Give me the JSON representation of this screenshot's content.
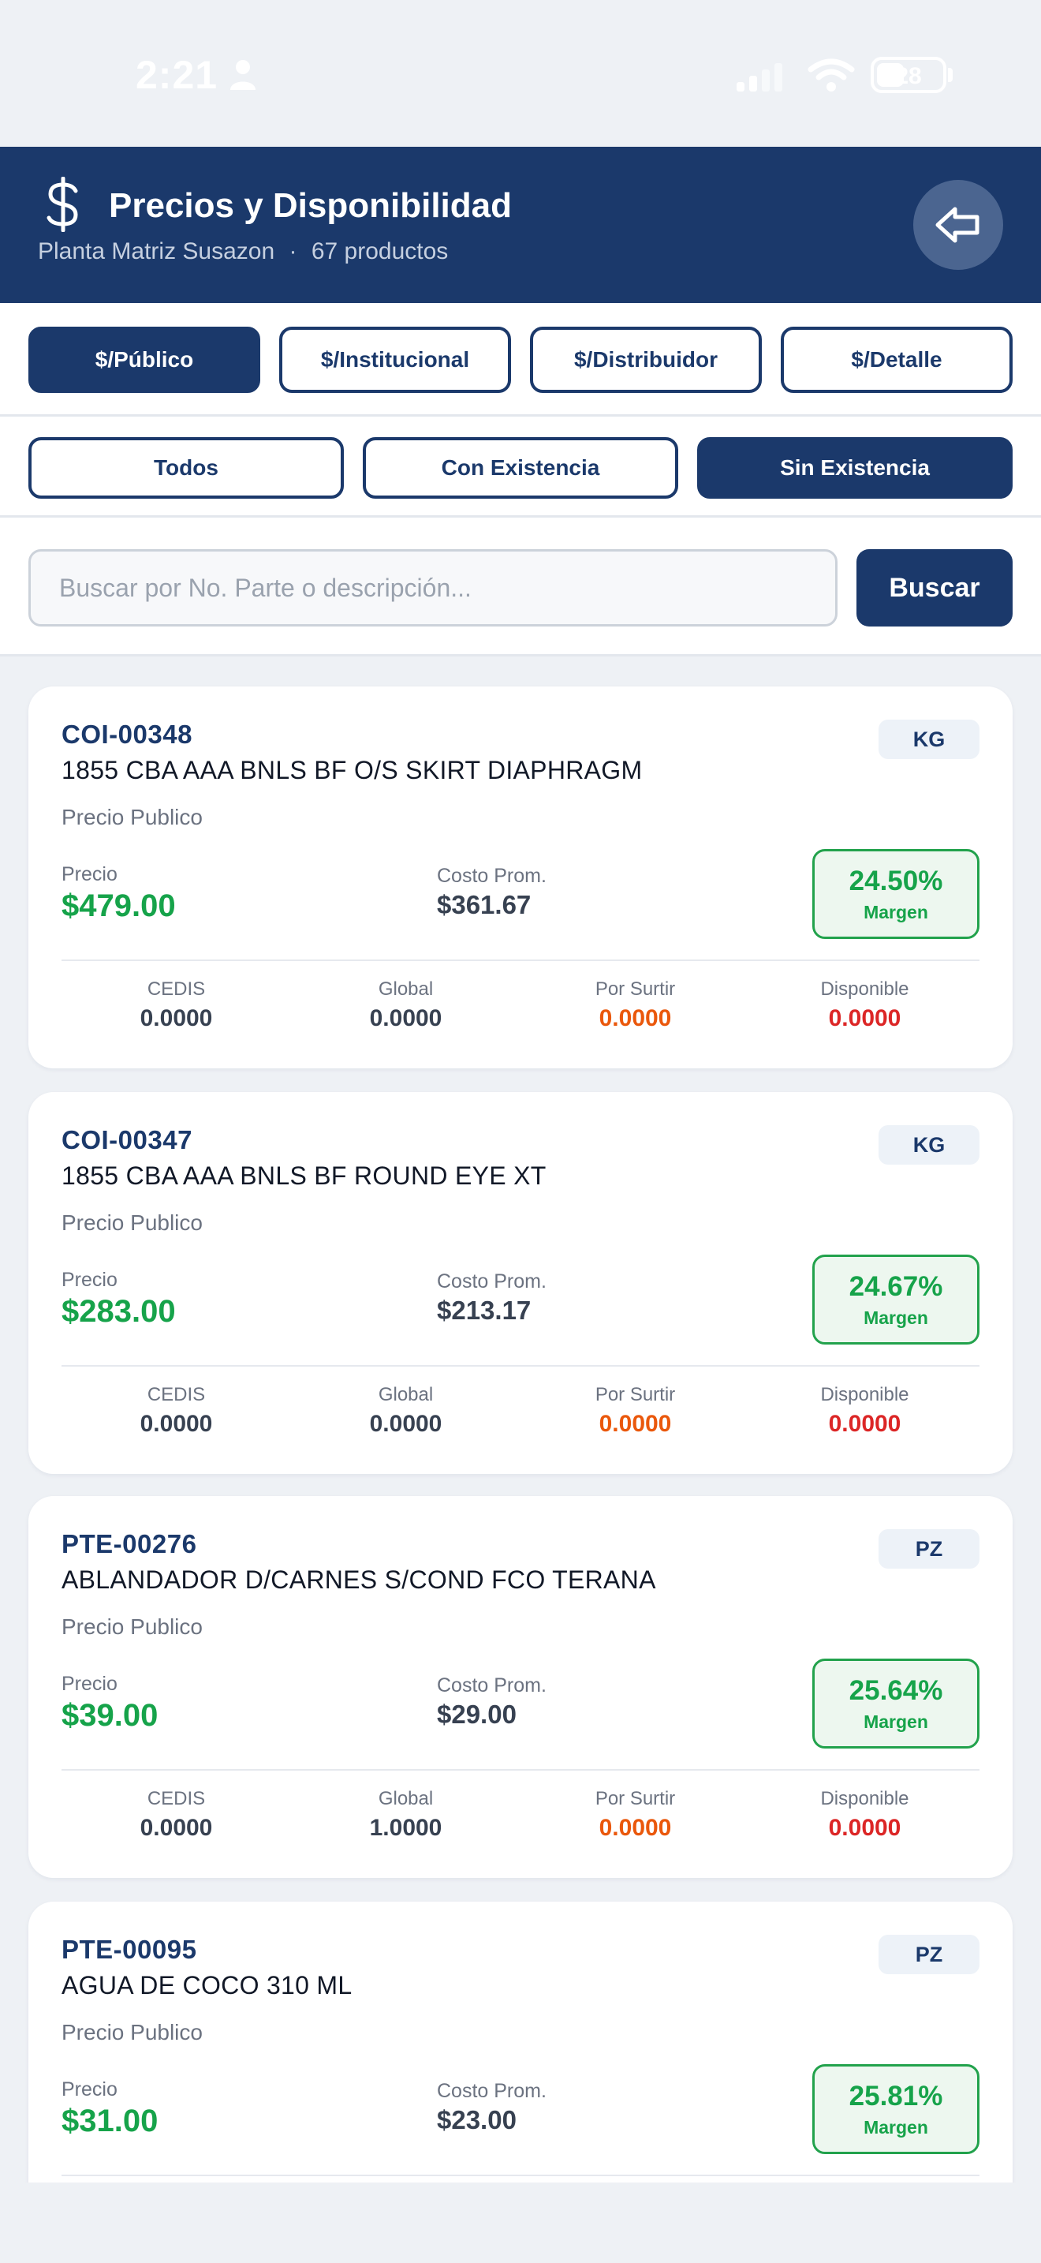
{
  "status_bar": {
    "time": "2:21",
    "battery": "28"
  },
  "header": {
    "title": "Precios y Disponibilidad",
    "plant": "Planta Matriz Susazon",
    "separator": "·",
    "count": "67 productos",
    "icon": "dollar-icon",
    "back_icon": "back-arrow-icon"
  },
  "price_tabs": [
    {
      "label": "$/Público",
      "active": true
    },
    {
      "label": "$/Institucional",
      "active": false
    },
    {
      "label": "$/Distribuidor",
      "active": false
    },
    {
      "label": "$/Detalle",
      "active": false
    }
  ],
  "stock_filters": [
    {
      "label": "Todos",
      "active": false
    },
    {
      "label": "Con Existencia",
      "active": false
    },
    {
      "label": "Sin Existencia",
      "active": true
    }
  ],
  "search": {
    "placeholder": "Buscar por No. Parte o descripción...",
    "value": "",
    "button_label": "Buscar"
  },
  "labels": {
    "price": "Precio",
    "cost": "Costo Prom.",
    "margin": "Margen",
    "cedis": "CEDIS",
    "global": "Global",
    "por_surtir": "Por Surtir",
    "disponible": "Disponible"
  },
  "products": [
    {
      "code": "COI-00348",
      "description": "1855 CBA AAA BNLS BF O/S SKIRT DIAPHRAGM",
      "unit": "KG",
      "price_type": "Precio Publico",
      "price": "$479.00",
      "cost": "$361.67",
      "margin": "24.50%",
      "cedis": "0.0000",
      "global": "0.0000",
      "por_surtir": "0.0000",
      "disponible": "0.0000"
    },
    {
      "code": "COI-00347",
      "description": "1855 CBA AAA BNLS BF ROUND EYE XT",
      "unit": "KG",
      "price_type": "Precio Publico",
      "price": "$283.00",
      "cost": "$213.17",
      "margin": "24.67%",
      "cedis": "0.0000",
      "global": "0.0000",
      "por_surtir": "0.0000",
      "disponible": "0.0000"
    },
    {
      "code": "PTE-00276",
      "description": "ABLANDADOR D/CARNES S/COND FCO TERANA",
      "unit": "PZ",
      "price_type": "Precio Publico",
      "price": "$39.00",
      "cost": "$29.00",
      "margin": "25.64%",
      "cedis": "0.0000",
      "global": "1.0000",
      "por_surtir": "0.0000",
      "disponible": "0.0000"
    },
    {
      "code": "PTE-00095",
      "description": "AGUA DE COCO 310 ML",
      "unit": "PZ",
      "price_type": "Precio Publico",
      "price": "$31.00",
      "cost": "$23.00",
      "margin": "25.81%",
      "cedis": "",
      "global": "",
      "por_surtir": "",
      "disponible": ""
    }
  ]
}
